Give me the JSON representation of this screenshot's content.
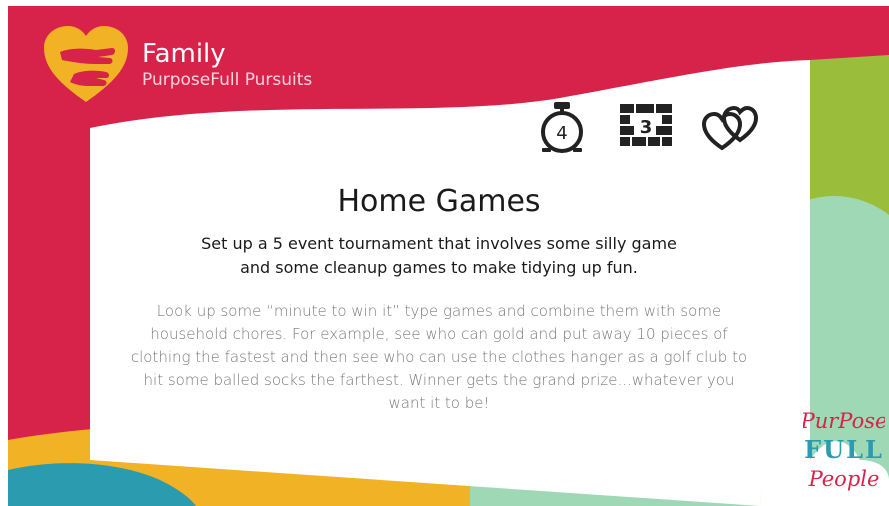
{
  "brand": {
    "title": "Family",
    "subtitle": "PurposeFull Pursuits",
    "icon": "heart-hands-icon"
  },
  "card": {
    "icons": [
      "stopwatch-icon",
      "brick-wall-icon",
      "hearts-icon"
    ],
    "timer_value": "4",
    "wall_value": "3",
    "title": "Home Games",
    "lead": "Set up a 5 event tournament that involves some silly game and some cleanup games to make tidying up fun.",
    "body": "Look up some “minute to win it” type games and combine them with some household chores. For example, see who can gold and put away 10 pieces of clothing the fastest and then see who can use the clothes hanger as a golf club to hit some balled socks the farthest. Winner gets the grand prize...whatever you want it to be!"
  },
  "wordmark": {
    "line1": "PurPose",
    "line2": "FULL",
    "line3": "People"
  },
  "colors": {
    "crimson": "#d7234a",
    "green": "#9bbd3c",
    "mint": "#9fd8b5",
    "yellow": "#f2b226",
    "teal": "#2b9bb0",
    "icon": "#222222"
  }
}
